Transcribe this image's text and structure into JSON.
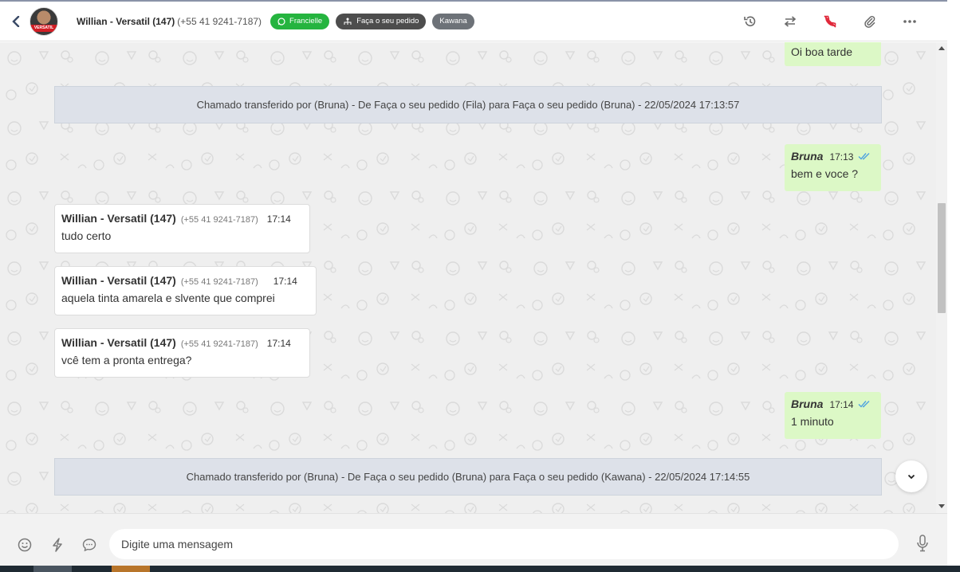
{
  "header": {
    "contact_name": "Willian - Versatil (147)",
    "contact_phone": "(+55 41 9241-7187)",
    "avatar_brand": "VERSATIL",
    "tags": [
      {
        "label": "Francielle",
        "icon": "whatsapp-icon",
        "color": "#25b43f"
      },
      {
        "label": "Faça o seu pedido",
        "icon": "queue-icon",
        "color": "#4d4d4d"
      },
      {
        "label": "Kawana",
        "icon": "",
        "color": "#6d7278"
      }
    ],
    "actions": [
      "history-icon",
      "transfer-icon",
      "end-call-icon",
      "attach-icon",
      "more-icon"
    ]
  },
  "messages": {
    "m0": {
      "text": "Oi boa tarde"
    },
    "sys1": {
      "text": "Chamado transferido por (Bruna) - De Faça o seu pedido (Fila) para Faça o seu pedido (Bruna) - 22/05/2024 17:13:57"
    },
    "m1": {
      "sender": "Bruna",
      "time": "17:13",
      "text": "bem e voce ?"
    },
    "m2": {
      "sender": "Willian - Versatil (147)",
      "phone": "(+55 41 9241-7187)",
      "time": "17:14",
      "text": "tudo certo"
    },
    "m3": {
      "sender": "Willian - Versatil (147)",
      "phone": "(+55 41 9241-7187)",
      "time": "17:14",
      "text": "aquela tinta amarela e slvente que comprei"
    },
    "m4": {
      "sender": "Willian - Versatil (147)",
      "phone": "(+55 41 9241-7187)",
      "time": "17:14",
      "text": "vcê tem a pronta entrega?"
    },
    "m5": {
      "sender": "Bruna",
      "time": "17:14",
      "text": "1 minuto"
    },
    "sys2": {
      "text": "Chamado transferido por (Bruna) - De Faça o seu pedido (Bruna) para Faça o seu pedido (Kawana) - 22/05/2024 17:14:55"
    }
  },
  "composer": {
    "placeholder": "Digite uma mensagem",
    "icons": [
      "emoji-icon",
      "quick-reply-icon",
      "chat-bubble-icon",
      "microphone-icon"
    ]
  },
  "colors": {
    "outgoing_bubble": "#dcf8c6",
    "system_bubble": "#dde1e9",
    "read_ticks": "#4fa3e0",
    "end_call": "#e0283a",
    "tag_green": "#25b43f"
  }
}
